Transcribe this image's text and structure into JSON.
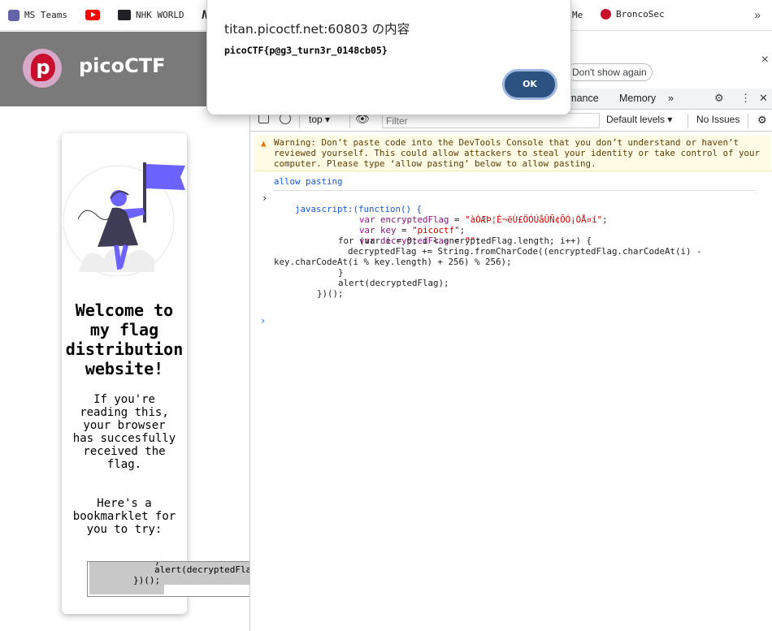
{
  "bookmarks": {
    "items": [
      {
        "label": "MS Teams",
        "icon": "ms-teams-icon",
        "color": "#6264a7"
      },
      {
        "label": "",
        "icon": "youtube-icon",
        "color": "#ff0000"
      },
      {
        "label": "NHK WORLD",
        "icon": "nhk-icon",
        "color": "#202124"
      },
      {
        "label": "N",
        "icon": "bookmark-n-icon",
        "color": "#202124"
      },
      {
        "label": "Me",
        "icon": "bookmark-icon",
        "color": "#202124"
      },
      {
        "label": "BroncoSec",
        "icon": "broncosec-icon",
        "color": "#c8102e"
      }
    ],
    "overflow": "»"
  },
  "pico": {
    "logo_letter": "p",
    "title": "picoCTF"
  },
  "card": {
    "heading": "Welcome to my flag distribution website!",
    "para1": "If you're reading this, your browser has succesfully received the flag.",
    "para2": "Here's a bookmarklet for you to try:",
    "code_line1": ")",
    "code_line2": "alert(decryptedFla",
    "code_line3": "})();"
  },
  "dialog": {
    "title": "titan.picoctf.net:60803 の内容",
    "message": "picoCTF{p@g3_turn3r_0148cb05}",
    "ok_label": "OK"
  },
  "devtools": {
    "close": "×",
    "dont_show_again": "Don't show again",
    "tabs": [
      "rmance",
      "Memory",
      "»"
    ],
    "toolbar": {
      "context": "top",
      "filter_placeholder": "Filter",
      "levels": "Default levels",
      "issues": "No Issues"
    },
    "warning": "Warning: Don’t paste code into the DevTools Console that you don’t understand or haven’t reviewed yourself. This could allow attackers to steal your identity or take control of your computer. Please type ‘allow pasting’ below to allow pasting.",
    "allow_pasting": "allow pasting",
    "code": {
      "l1": "javascript:(function() {",
      "l2a": "var ",
      "l2b": "encryptedFlag",
      "l2c": " = ",
      "l2d": "\"àÒÆÞ¦È¬ëÙ£ÖÓÚåÛÑ¢ÕÓ¡ÒÅ¤í\"",
      "l2e": ";",
      "l3a": "var ",
      "l3b": "key",
      "l3c": " = ",
      "l3d": "\"picoctf\"",
      "l3e": ";",
      "l4a": "var ",
      "l4b": "decryptedFlag",
      "l4c": " = ",
      "l4d": "\"\"",
      "l4e": ";",
      "l5": "for (var i = 0; i < encryptedFlag.length; i++) {",
      "l6": "decryptedFlag += String.fromCharCode((encryptedFlag.charCodeAt(i) -",
      "l7": "key.charCodeAt(i % key.length) + 256) % 256);",
      "l8": "}",
      "l9": "alert(decryptedFlag);",
      "l10": "})();"
    }
  }
}
